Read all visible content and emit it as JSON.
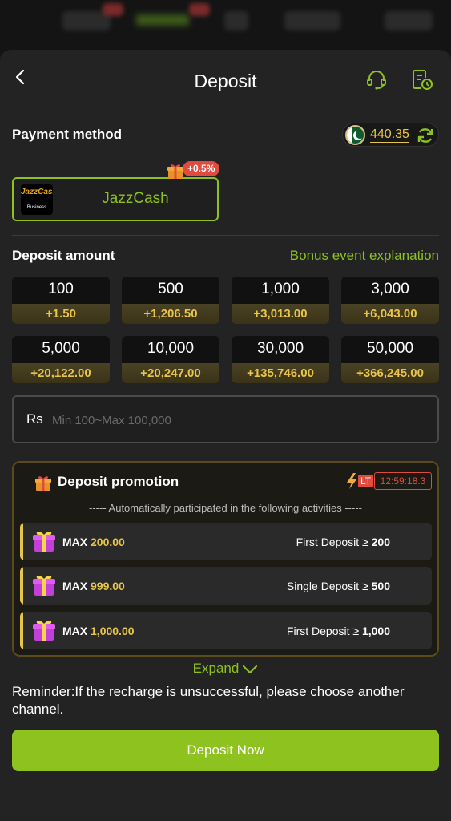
{
  "header": {
    "title": "Deposit"
  },
  "payment": {
    "section_title": "Payment method",
    "balance": "440.35",
    "method": {
      "name": "JazzCash",
      "logo_text": "JazzCash",
      "logo_sub": "Business",
      "bonus_badge": "+0.5%"
    }
  },
  "deposit": {
    "section_title": "Deposit amount",
    "bonus_link": "Bonus event explanation",
    "amounts": [
      {
        "value": "100",
        "bonus": "+1.50"
      },
      {
        "value": "500",
        "bonus": "+1,206.50"
      },
      {
        "value": "1,000",
        "bonus": "+3,013.00"
      },
      {
        "value": "3,000",
        "bonus": "+6,043.00"
      },
      {
        "value": "5,000",
        "bonus": "+20,122.00"
      },
      {
        "value": "10,000",
        "bonus": "+20,247.00"
      },
      {
        "value": "30,000",
        "bonus": "+135,746.00"
      },
      {
        "value": "50,000",
        "bonus": "+366,245.00"
      }
    ],
    "input": {
      "currency": "Rs",
      "placeholder": "Min 100~Max 100,000",
      "value": ""
    }
  },
  "promotion": {
    "title": "Deposit promotion",
    "lt_label": "LT",
    "timer": "12:59:18.3",
    "subtitle": "----- Automatically participated in the following activities -----",
    "items": [
      {
        "max_label": "MAX",
        "max_value": "200.00",
        "condition": "First Deposit ≥",
        "threshold": "200"
      },
      {
        "max_label": "MAX",
        "max_value": "999.00",
        "condition": "Single Deposit ≥",
        "threshold": "500"
      },
      {
        "max_label": "MAX",
        "max_value": "1,000.00",
        "condition": "First Deposit ≥",
        "threshold": "1,000"
      }
    ],
    "expand_label": "Expand"
  },
  "reminder": "Reminder:If the recharge is unsuccessful, please choose another channel.",
  "deposit_button": "Deposit Now",
  "colors": {
    "accent": "#8dc21f",
    "gold": "#e8c54a",
    "alert": "#e04a3f",
    "background": "#232323"
  }
}
